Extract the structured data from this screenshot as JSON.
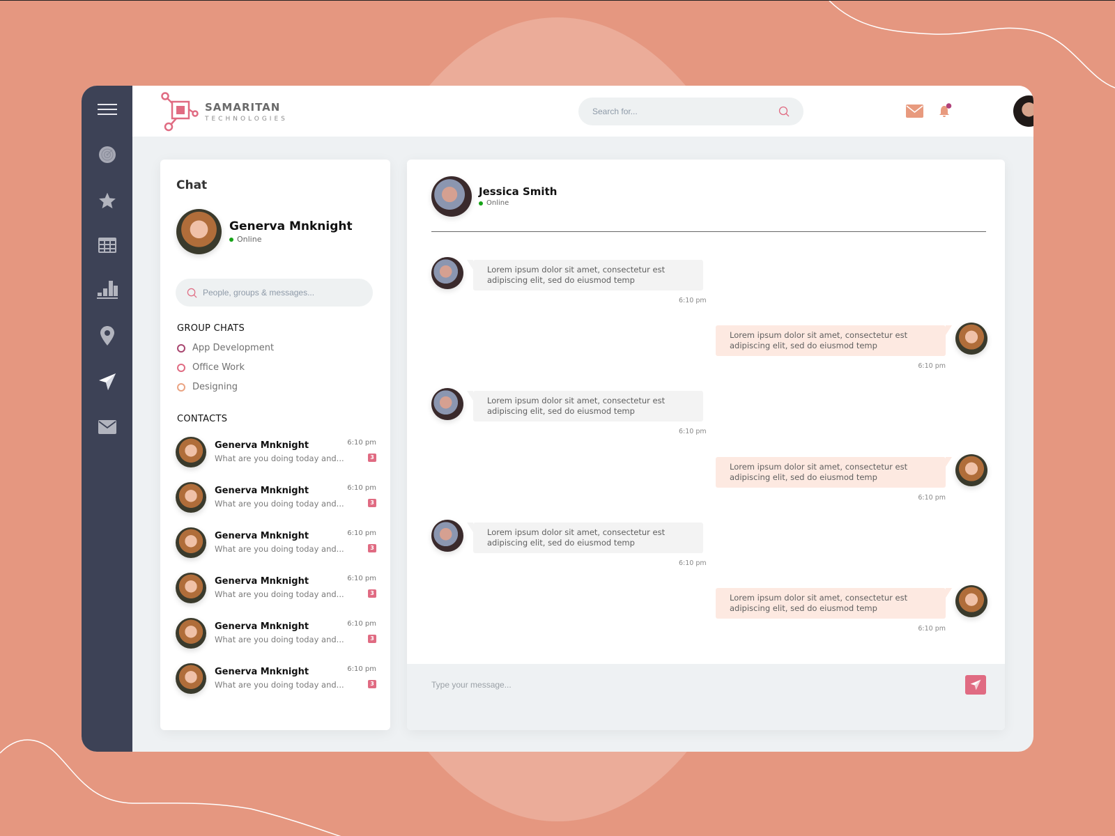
{
  "brand": {
    "title": "SAMARITAN",
    "subtitle": "TECHNOLOGIES",
    "accent": "#e06b82"
  },
  "sidebar": {
    "items": [
      {
        "name": "menu",
        "icon": "hamburger-icon"
      },
      {
        "name": "dashboard",
        "icon": "radar-icon"
      },
      {
        "name": "favorites",
        "icon": "star-icon"
      },
      {
        "name": "tables",
        "icon": "table-icon"
      },
      {
        "name": "analytics",
        "icon": "bar-chart-icon"
      },
      {
        "name": "location",
        "icon": "map-pin-icon"
      },
      {
        "name": "send",
        "icon": "paper-plane-icon"
      },
      {
        "name": "mail",
        "icon": "mail-icon"
      }
    ]
  },
  "header": {
    "search_placeholder": "Search for...",
    "icons": [
      "mail-icon",
      "bell-icon",
      "search-icon"
    ],
    "notification_dot_color": "#b0417a"
  },
  "chat_panel": {
    "title": "Chat",
    "me": {
      "name": "Generva Mnknight",
      "status": "Online"
    },
    "search_placeholder": "People, groups & messages...",
    "group_chats_title": "GROUP CHATS",
    "groups": [
      {
        "label": "App Development",
        "color": "#a8466f"
      },
      {
        "label": "Office Work",
        "color": "#e06b82"
      },
      {
        "label": "Designing",
        "color": "#eaa382"
      }
    ],
    "contacts_title": "CONTACTS",
    "contacts": [
      {
        "name": "Generva Mnknight",
        "preview": "What are you doing today and...",
        "time": "6:10 pm",
        "unread": "3"
      },
      {
        "name": "Generva Mnknight",
        "preview": "What are you doing today and...",
        "time": "6:10 pm",
        "unread": "3"
      },
      {
        "name": "Generva Mnknight",
        "preview": "What are you doing today and...",
        "time": "6:10 pm",
        "unread": "3"
      },
      {
        "name": "Generva Mnknight",
        "preview": "What are you doing today and...",
        "time": "6:10 pm",
        "unread": "3"
      },
      {
        "name": "Generva Mnknight",
        "preview": "What are you doing today and...",
        "time": "6:10 pm",
        "unread": "3"
      },
      {
        "name": "Generva Mnknight",
        "preview": "What are you doing today and...",
        "time": "6:10 pm",
        "unread": "3"
      }
    ]
  },
  "conversation": {
    "contact": {
      "name": "Jessica Smith",
      "status": "Online"
    },
    "messages": [
      {
        "direction": "in",
        "text": "Lorem ipsum dolor sit amet, consectetur est adipiscing elit, sed do eiusmod temp",
        "time": "6:10 pm"
      },
      {
        "direction": "out",
        "text": "Lorem ipsum dolor sit amet, consectetur est adipiscing elit, sed do eiusmod temp",
        "time": "6:10 pm"
      },
      {
        "direction": "in",
        "text": "Lorem ipsum dolor sit amet, consectetur est adipiscing elit, sed do eiusmod temp",
        "time": "6:10 pm"
      },
      {
        "direction": "out",
        "text": "Lorem ipsum dolor sit amet, consectetur est adipiscing elit, sed do eiusmod temp",
        "time": "6:10 pm"
      },
      {
        "direction": "in",
        "text": "Lorem ipsum dolor sit amet, consectetur est adipiscing elit, sed do eiusmod temp",
        "time": "6:10 pm"
      },
      {
        "direction": "out",
        "text": "Lorem ipsum dolor sit amet, consectetur est adipiscing elit, sed do eiusmod temp",
        "time": "6:10 pm"
      }
    ],
    "composer_placeholder": "Type your message...",
    "send_icon": "paper-plane-icon"
  }
}
